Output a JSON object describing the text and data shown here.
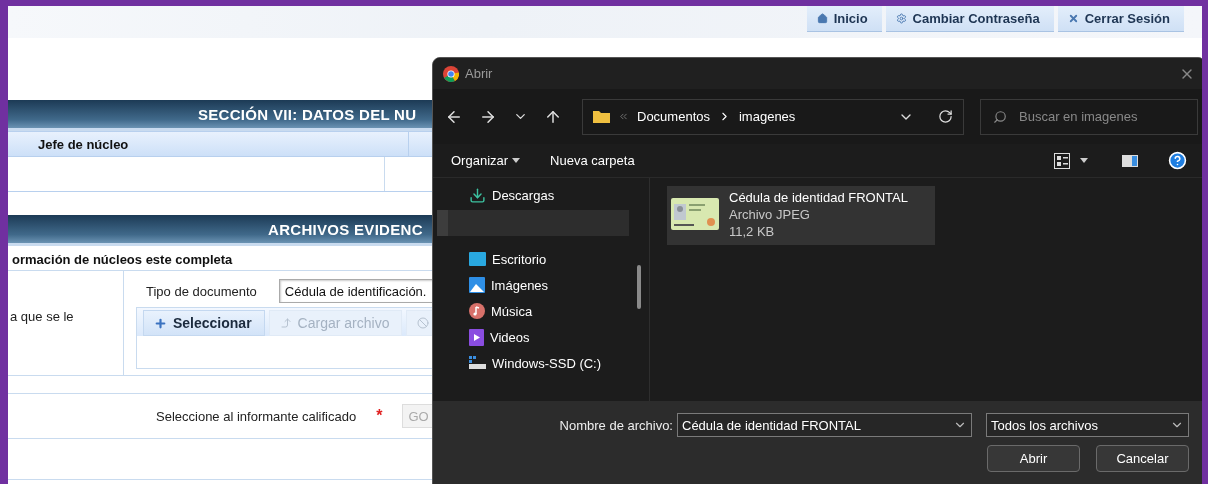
{
  "top_nav": [
    {
      "label": "Inicio"
    },
    {
      "label": "Cambiar Contraseña"
    },
    {
      "label": "Cerrar Sesión"
    }
  ],
  "section_vii": {
    "title": "SECCIÓN VII: DATOS DEL NU",
    "columns": [
      "Jefe de núcleo"
    ]
  },
  "evidence": {
    "title": "ARCHIVOS EVIDENC",
    "notice": "ormación de núcleos este completa",
    "row_label": "a que se le",
    "document_type_label": "Tipo de documento",
    "document_type_value": "Cédula de identificación.",
    "buttons": [
      {
        "label": "Seleccionar",
        "kind": "add",
        "disabled": false
      },
      {
        "label": "Cargar archivo",
        "kind": "upload",
        "disabled": true
      },
      {
        "kind": "cancel",
        "disabled": true
      }
    ]
  },
  "informant": {
    "label": "Seleccione al informante calificado",
    "required_marker": "*",
    "value": "GO",
    "disabled": true
  },
  "dialog": {
    "title": "Abrir",
    "path": [
      "Documentos",
      "imagenes"
    ],
    "search": {
      "placeholder": "Buscar en imagenes"
    },
    "toolbar": [
      "Organizar",
      "Nueva carpeta"
    ],
    "nav_items": [
      {
        "label": "Descargas"
      },
      {
        "label": "Escritorio"
      },
      {
        "label": "Imágenes"
      },
      {
        "label": "Música"
      },
      {
        "label": "Videos"
      },
      {
        "label": "Windows-SSD (C:)"
      }
    ],
    "files": [
      {
        "name": "Cédula de identidad FRONTAL",
        "type": "Archivo JPEG",
        "size": "11,2 KB",
        "selected": true
      }
    ],
    "file_name_label": "Nombre de archivo:",
    "file_name": "Cédula de identidad FRONTAL",
    "file_type": "Todos los archivos",
    "buttons": [
      "Abrir",
      "Cancelar"
    ]
  }
}
